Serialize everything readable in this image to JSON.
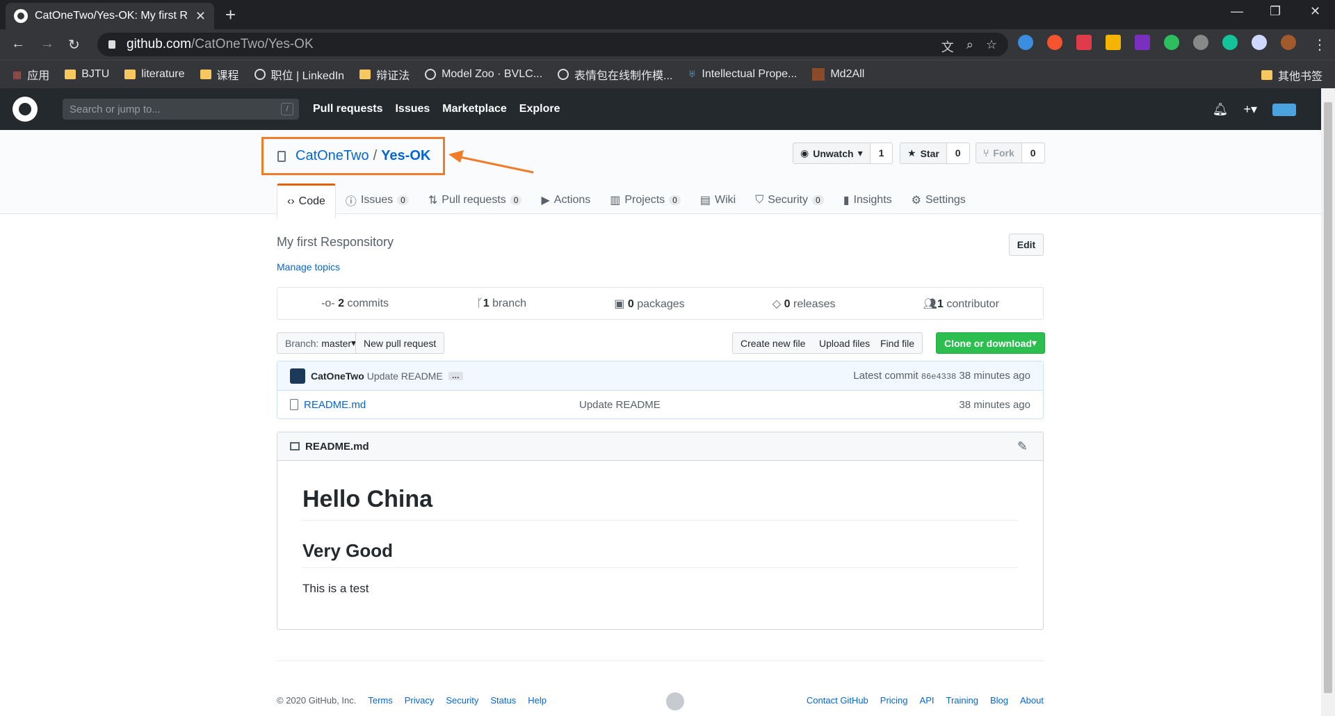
{
  "browser": {
    "tab_title": "CatOneTwo/Yes-OK: My first R",
    "url_host": "github.com",
    "url_path": "/CatOneTwo/Yes-OK",
    "bookmarks": [
      "应用",
      "BJTU",
      "literature",
      "课程",
      "职位 | LinkedIn",
      "辩证法",
      "Model Zoo · BVLC...",
      "表情包在线制作模...",
      "Intellectual Prope...",
      "Md2All"
    ],
    "other_bookmarks": "其他书签"
  },
  "github": {
    "search_placeholder": "Search or jump to...",
    "search_key": "/",
    "nav": [
      "Pull requests",
      "Issues",
      "Marketplace",
      "Explore"
    ]
  },
  "repo": {
    "owner": "CatOneTwo",
    "sep": "/",
    "name": "Yes-OK",
    "watch_label": "Unwatch",
    "watch_count": "1",
    "star_label": "Star",
    "star_count": "0",
    "fork_label": "Fork",
    "fork_count": "0",
    "tabs": [
      {
        "label": "Code",
        "count": ""
      },
      {
        "label": "Issues",
        "count": "0"
      },
      {
        "label": "Pull requests",
        "count": "0"
      },
      {
        "label": "Actions",
        "count": ""
      },
      {
        "label": "Projects",
        "count": "0"
      },
      {
        "label": "Wiki",
        "count": ""
      },
      {
        "label": "Security",
        "count": "0"
      },
      {
        "label": "Insights",
        "count": ""
      },
      {
        "label": "Settings",
        "count": ""
      }
    ],
    "description": "My first Responsitory",
    "manage_topics": "Manage topics",
    "edit": "Edit",
    "summary": {
      "commits_n": "2",
      "commits": "commits",
      "branch_n": "1",
      "branch": "branch",
      "packages_n": "0",
      "packages": "packages",
      "releases_n": "0",
      "releases": "releases",
      "contributor_n": "1",
      "contributor": "contributor"
    },
    "branch_prefix": "Branch:",
    "branch_name": "master",
    "new_pr": "New pull request",
    "create_file": "Create new file",
    "upload": "Upload files",
    "find": "Find file",
    "clone": "Clone or download",
    "commit": {
      "author": "CatOneTwo",
      "message": "Update README",
      "ellipsis": "…",
      "latest_label": "Latest commit",
      "sha": "86e4338",
      "age": "38 minutes ago"
    },
    "file": {
      "name": "README.md",
      "message": "Update README",
      "age": "38 minutes ago"
    },
    "readme": {
      "title": "README.md",
      "h1": "Hello China",
      "h2": "Very Good",
      "p": "This is a test"
    }
  },
  "footer": {
    "copyright": "© 2020 GitHub, Inc.",
    "left": [
      "Terms",
      "Privacy",
      "Security",
      "Status",
      "Help"
    ],
    "right": [
      "Contact GitHub",
      "Pricing",
      "API",
      "Training",
      "Blog",
      "About"
    ]
  },
  "colors": {
    "accent": "#0366d6",
    "highlight": "#f07c2a",
    "green": "#2cbe4e"
  }
}
